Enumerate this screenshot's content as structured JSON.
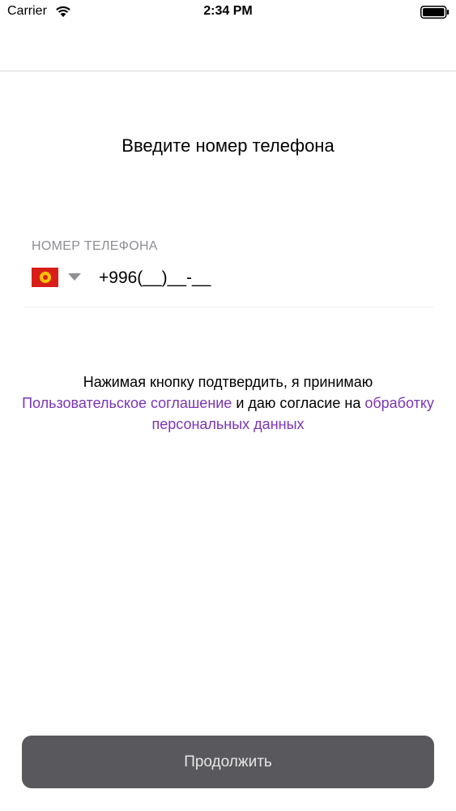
{
  "status_bar": {
    "carrier": "Carrier",
    "time": "2:34 PM",
    "wifi_icon": "wifi-icon",
    "battery_icon": "battery-icon"
  },
  "screen": {
    "title": "Введите номер телефона"
  },
  "phone_field": {
    "label": "НОМЕР ТЕЛЕФОНА",
    "country_flag_icon": "kyrgyzstan-flag-icon",
    "value": "+996(__)__-__"
  },
  "agreement": {
    "prefix": "Нажимая кнопку подтвердить, я принимаю",
    "terms_link": "Пользовательское соглашение",
    "middle": "и даю согласие на",
    "data_link": "обработку персональных данных"
  },
  "continue_button": {
    "label": "Продолжить"
  },
  "colors": {
    "link": "#7b35b5",
    "button_bg": "#59585c",
    "label_gray": "#8e8e93"
  }
}
